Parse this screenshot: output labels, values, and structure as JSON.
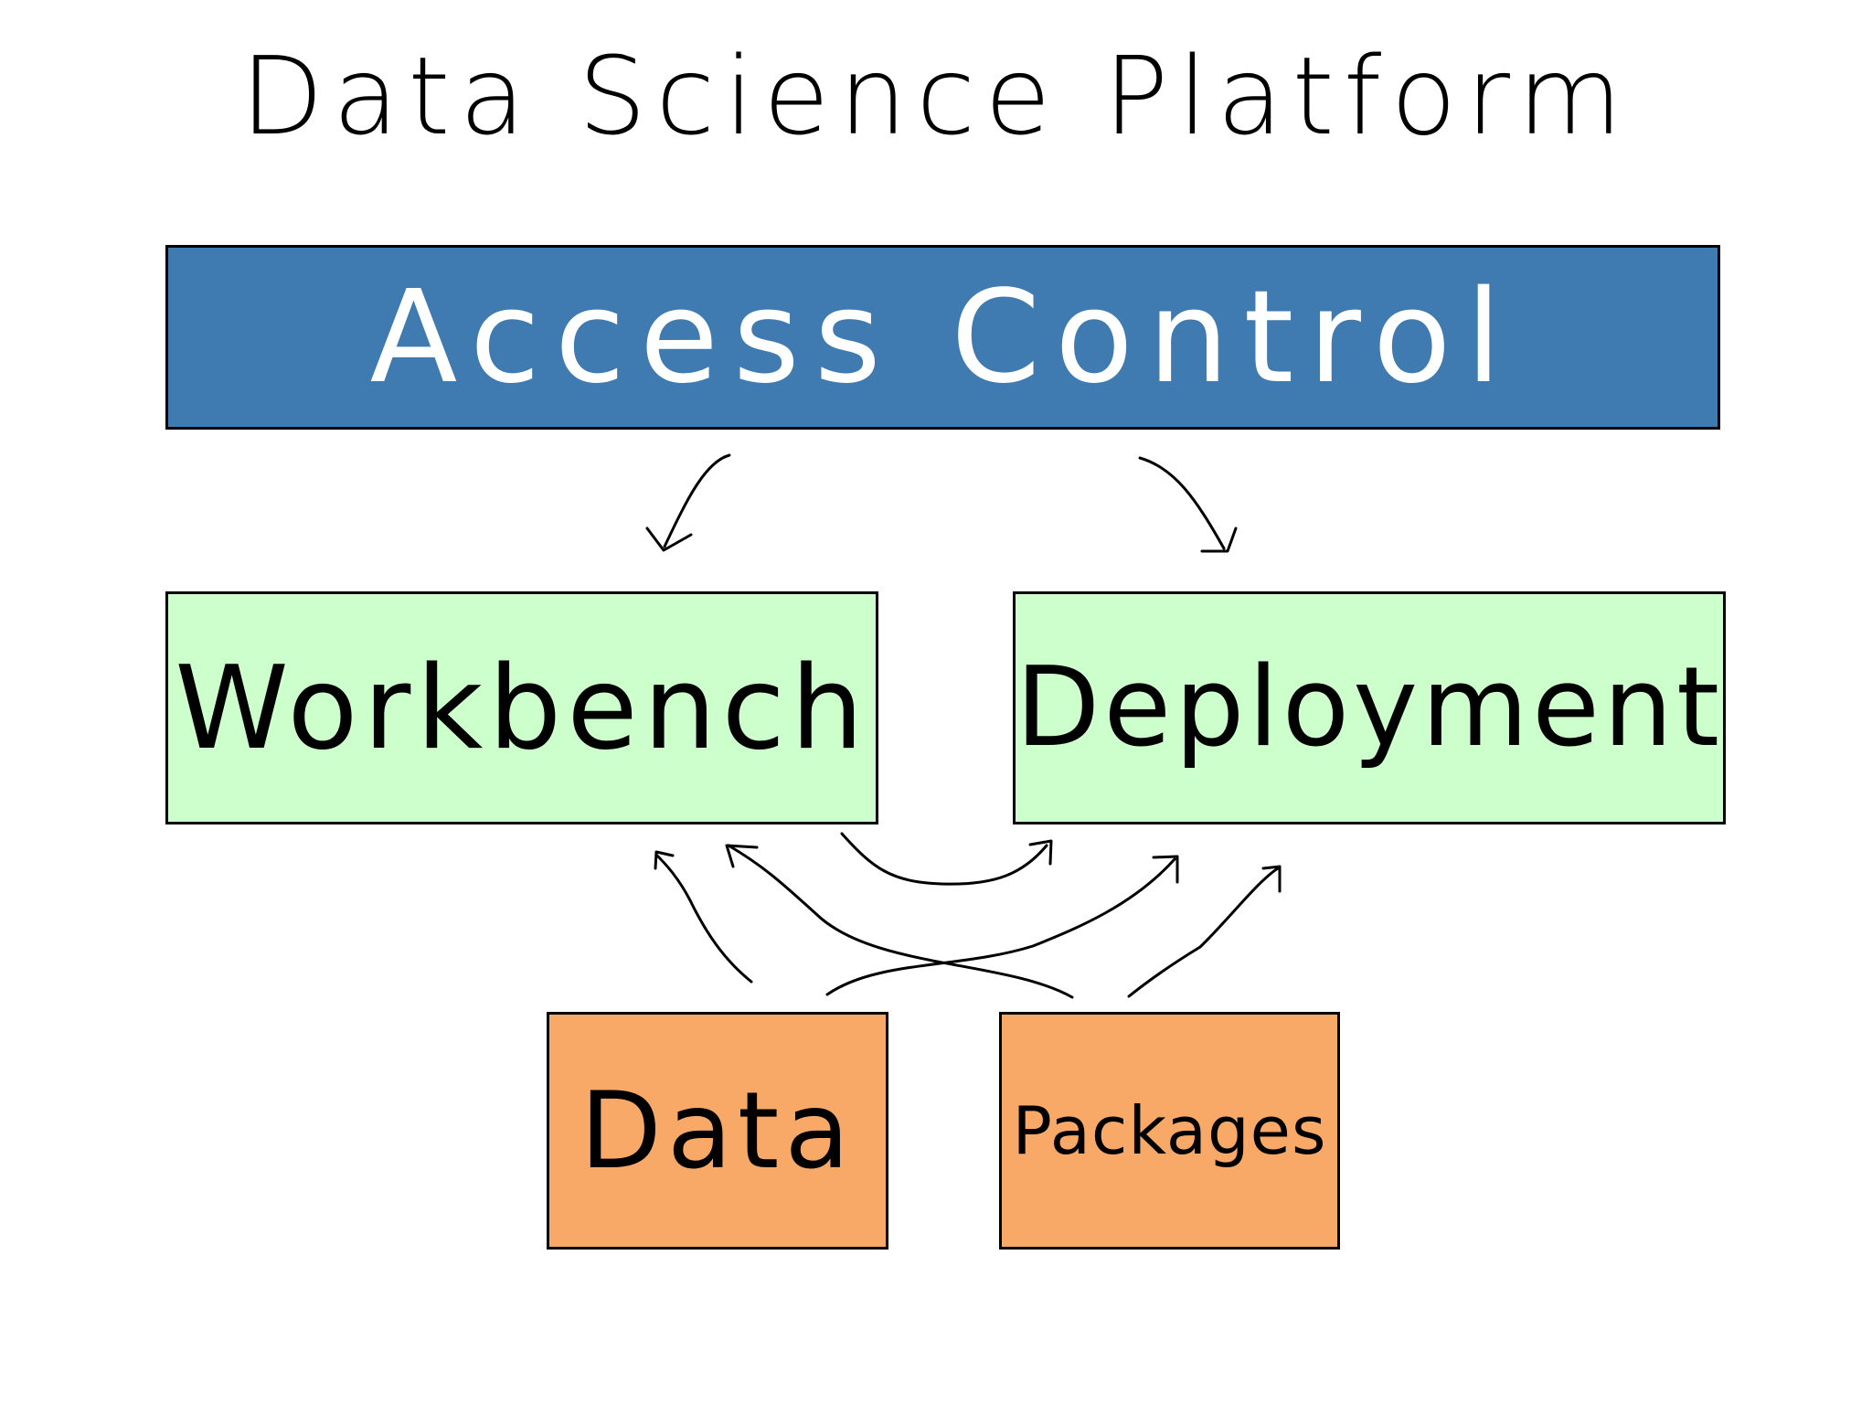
{
  "title": "Data Science Platform",
  "nodes": {
    "access_control": {
      "label": "Access Control",
      "color": "#3f7bb0"
    },
    "workbench": {
      "label": "Workbench",
      "color": "#ccffcc"
    },
    "deployment": {
      "label": "Deployment",
      "color": "#ccffcc"
    },
    "data": {
      "label": "Data",
      "color": "#f8a967"
    },
    "packages": {
      "label": "Packages",
      "color": "#f8a967"
    }
  },
  "edges": [
    {
      "from": "access_control",
      "to": "workbench"
    },
    {
      "from": "access_control",
      "to": "deployment"
    },
    {
      "from": "workbench",
      "to": "deployment"
    },
    {
      "from": "data",
      "to": "workbench"
    },
    {
      "from": "data",
      "to": "deployment"
    },
    {
      "from": "packages",
      "to": "workbench"
    },
    {
      "from": "packages",
      "to": "deployment"
    }
  ]
}
